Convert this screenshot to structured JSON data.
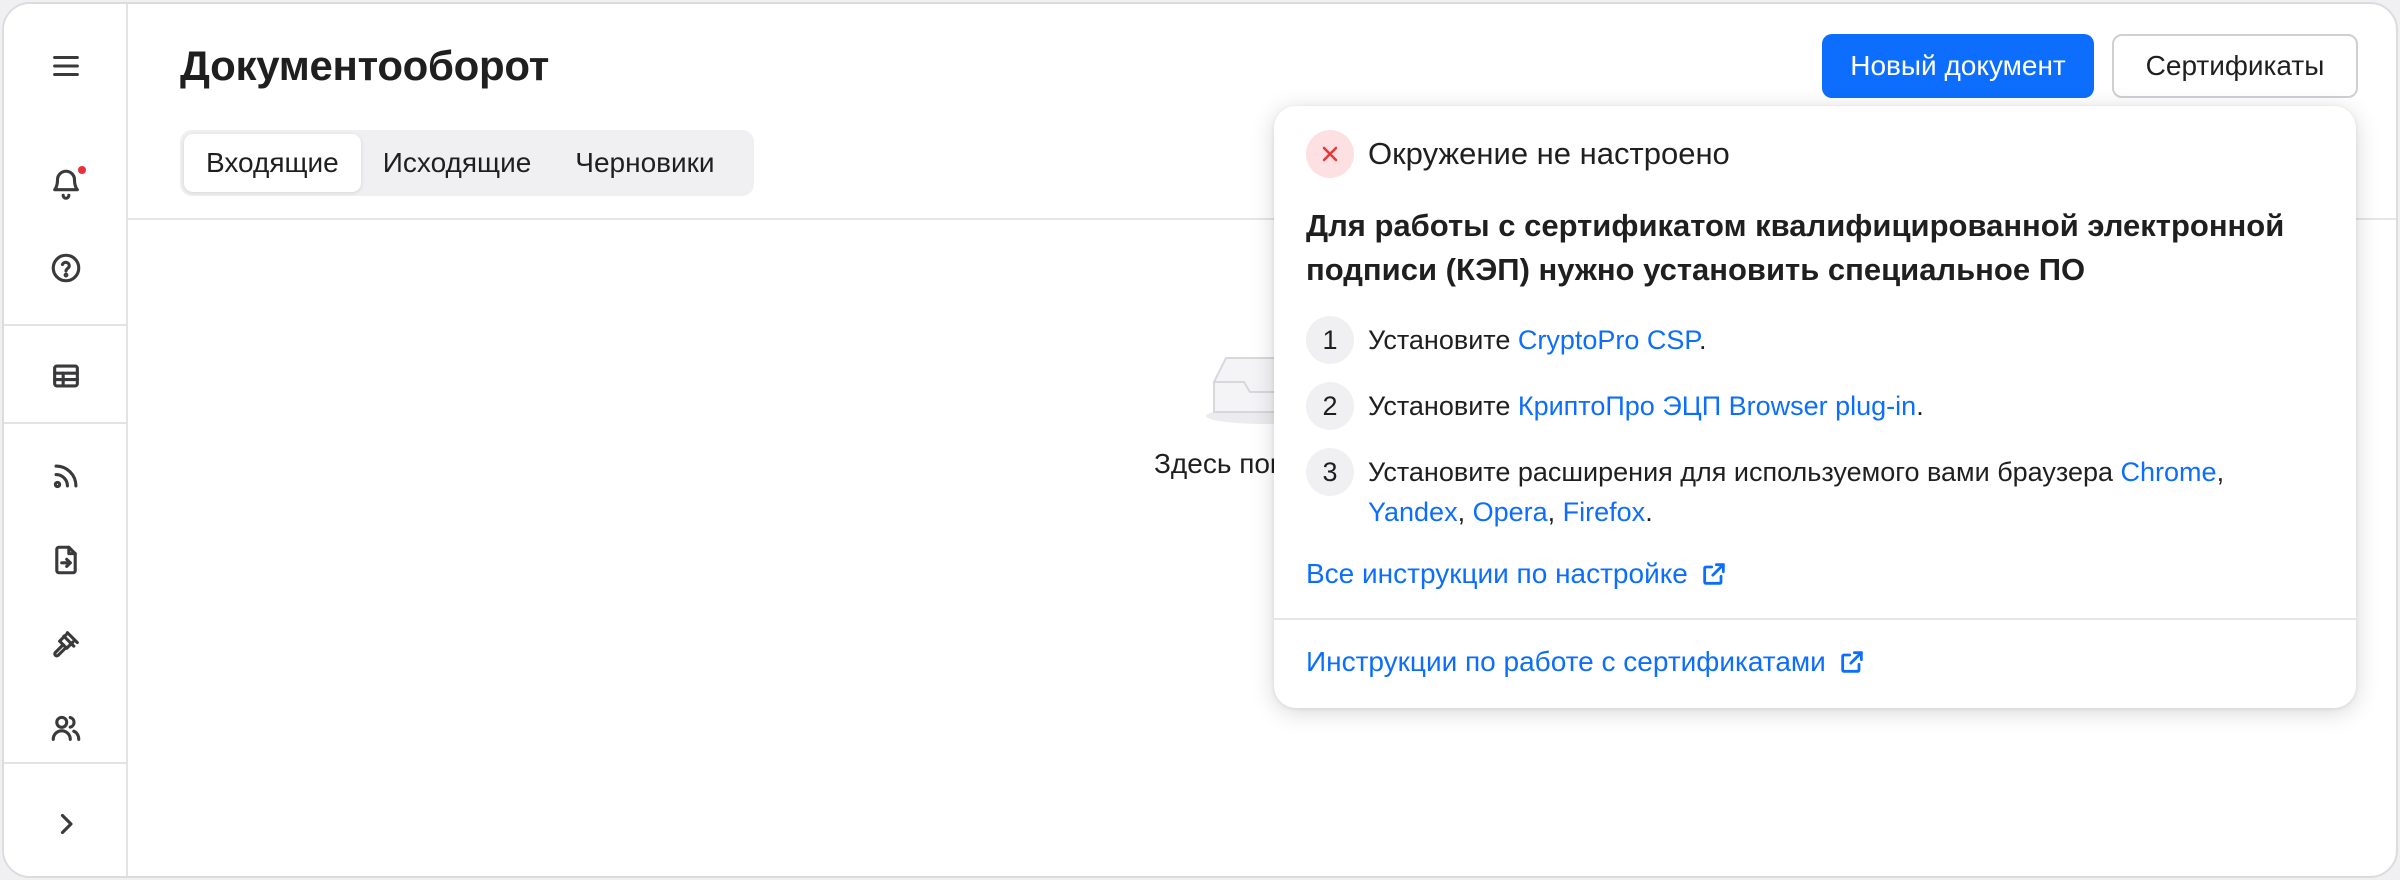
{
  "sidebar": {
    "items": [
      {
        "icon": "menu-icon"
      },
      {
        "icon": "bell-icon",
        "badge": true
      },
      {
        "icon": "help-icon"
      },
      {
        "icon": "table-icon"
      },
      {
        "icon": "rss-icon"
      },
      {
        "icon": "document-import-icon"
      },
      {
        "icon": "gavel-icon"
      },
      {
        "icon": "users-icon"
      },
      {
        "icon": "chevron-right-icon"
      }
    ]
  },
  "header": {
    "title": "Документооборот",
    "new_document_label": "Новый документ",
    "certificates_label": "Сертификаты"
  },
  "tabs": [
    {
      "label": "Входящие",
      "active": true
    },
    {
      "label": "Исходящие",
      "active": false
    },
    {
      "label": "Черновики",
      "active": false
    }
  ],
  "empty_state": {
    "text": "Здесь пок"
  },
  "popover": {
    "title": "Окружение не настроено",
    "lead": "Для работы с сертификатом квалифицированной электронной подписи (КЭП) нужно установить специальное ПО",
    "steps": [
      {
        "num": "1",
        "prefix": "Установите ",
        "link": "CryptoPro CSP",
        "suffix": "."
      },
      {
        "num": "2",
        "prefix": "Установите ",
        "link": "КриптоПро ЭЦП Browser plug-in",
        "suffix": "."
      },
      {
        "num": "3",
        "prefix": "Установите расширения для используемого вами браузера ",
        "links": [
          "Chrome",
          "Yandex",
          "Opera",
          "Firefox"
        ],
        "sep": ", ",
        "suffix": "."
      }
    ],
    "all_instructions_label": "Все инструкции по настройке",
    "cert_instructions_label": "Инструкции по работе с сертификатами"
  },
  "colors": {
    "accent": "#0d6efd",
    "error": "#e23b3b",
    "error_bg": "#fde0e2",
    "badge": "#e8313a"
  }
}
